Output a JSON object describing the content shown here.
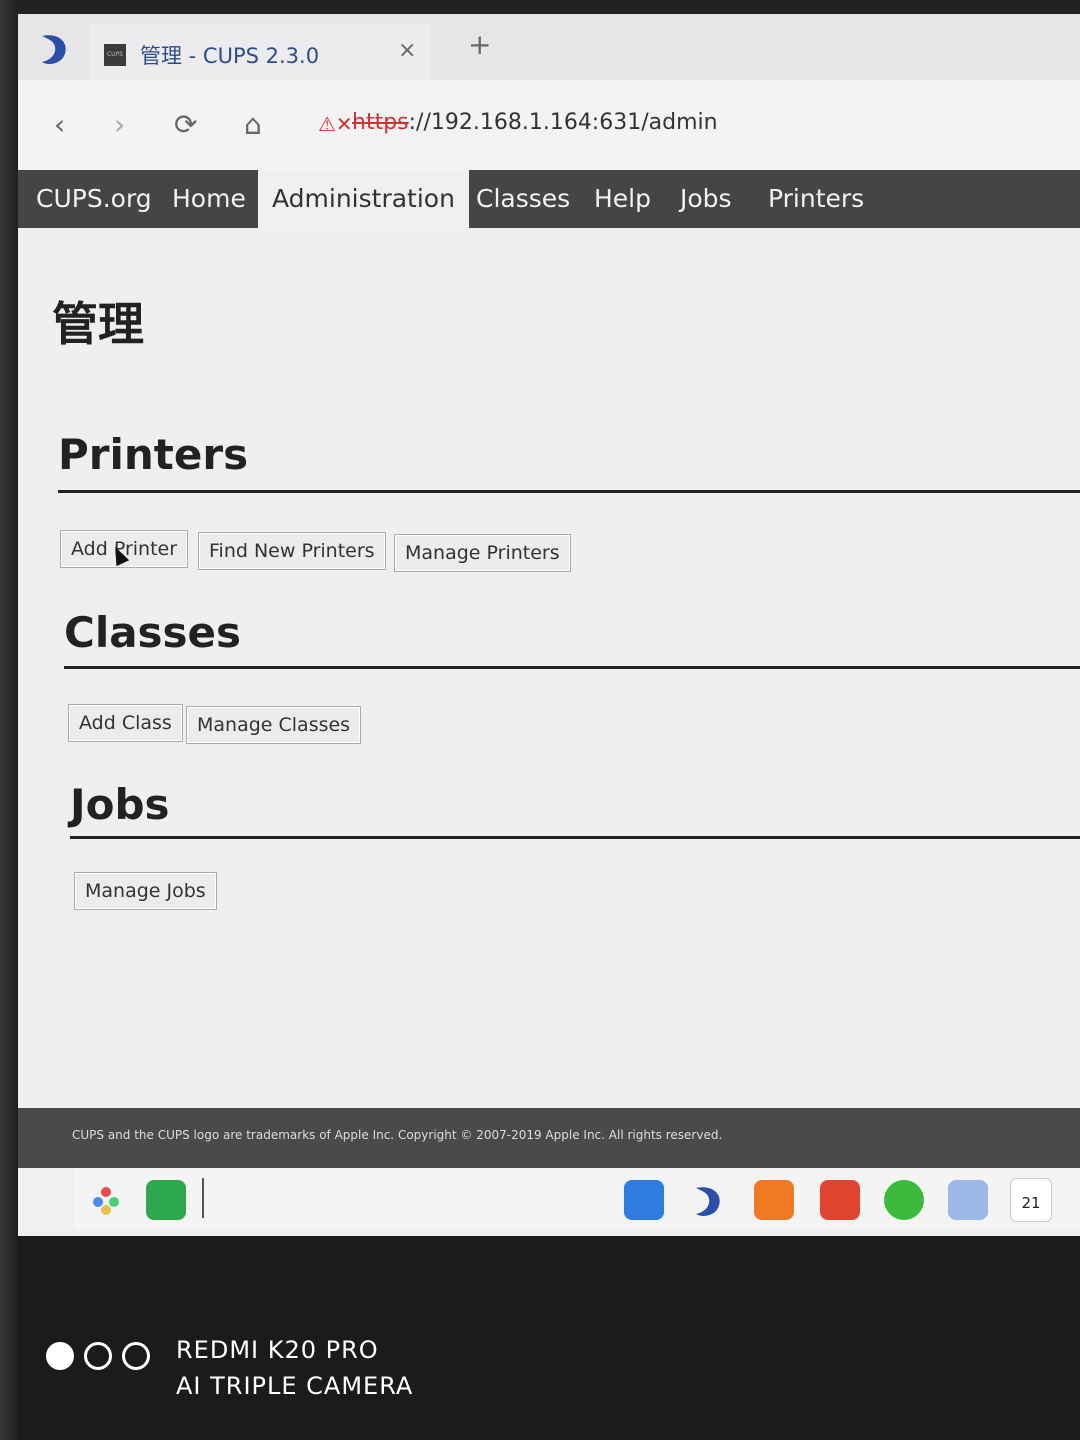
{
  "browser": {
    "tab_title": "管理 - CUPS 2.3.0",
    "tab_favicon_text": "CUPS",
    "close_glyph": "×",
    "new_tab_glyph": "+",
    "back_glyph": "‹",
    "forward_glyph": "›",
    "reload_glyph": "⟳",
    "home_glyph": "⌂",
    "url_warning": "⚠✕",
    "url_scheme": "https",
    "url_rest": "://192.168.1.164:631/admin"
  },
  "nav": {
    "items": [
      "CUPS.org",
      "Home",
      "Administration",
      "Classes",
      "Help",
      "Jobs",
      "Printers"
    ],
    "active": "Administration"
  },
  "page": {
    "title": "管理",
    "sections": {
      "printers": {
        "title": "Printers",
        "buttons": [
          "Add Printer",
          "Find New Printers",
          "Manage Printers"
        ]
      },
      "classes": {
        "title": "Classes",
        "buttons": [
          "Add Class",
          "Manage Classes"
        ]
      },
      "jobs": {
        "title": "Jobs",
        "buttons": [
          "Manage Jobs"
        ]
      }
    }
  },
  "footer": {
    "text": "CUPS and the CUPS logo are trademarks of Apple Inc. Copyright © 2007-2019 Apple Inc. All rights reserved."
  },
  "dock": {
    "calendar_day": "21",
    "icons": [
      "launcher-icon",
      "terminal-icon",
      "app-store-icon",
      "browser-icon",
      "mail-icon",
      "presentation-icon",
      "music-icon",
      "files-icon",
      "calendar-icon"
    ]
  },
  "camera_watermark": {
    "line1": "REDMI K20 PRO",
    "line2": "AI TRIPLE CAMERA"
  },
  "colors": {
    "nav_bg": "#454548",
    "page_bg": "#efefef",
    "footer_bg": "#4a4a4d"
  }
}
